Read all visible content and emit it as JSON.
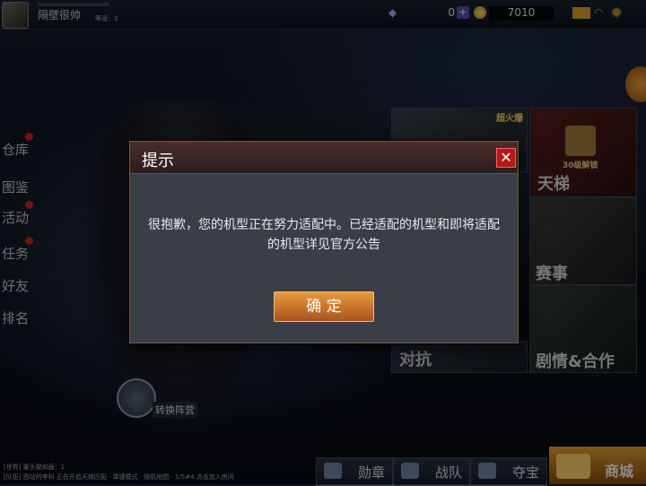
{
  "topbar": {
    "player_name": "隔壁很帅",
    "level": "等级：3",
    "gems": "0",
    "gem_plus": "+",
    "coins": "7010"
  },
  "left_menu": [
    "仓库",
    "图鉴",
    "活动",
    "任务",
    "好友",
    "排名"
  ],
  "tiles": {
    "ladder": "天梯",
    "ladder_badge": "30级解锁",
    "event": "赛事",
    "story": "剧情&合作",
    "versus": "对抗",
    "gun_badge": "超火爆"
  },
  "switch_label": "转换阵营",
  "chat": {
    "line1": "[世界] 董头渠如画：1",
    "line2": "[队伍] 西站的李科  正在开启天梯匹配 · 单键模式 · 随机地图 · 1/5#4  点击加入房间"
  },
  "bottom": {
    "medal": "勋章",
    "team": "战队",
    "treasure": "夺宝",
    "shop": "商城"
  },
  "dialog": {
    "title": "提示",
    "close_glyph": "✕",
    "message": "很抱歉，您的机型正在努力适配中。已经适配的机型和即将适配的机型详见官方公告",
    "ok_label": "确 定"
  },
  "colors": {
    "accent": "#e89a3c",
    "close": "#b81818",
    "dialog_bg": "#3a3e46"
  }
}
